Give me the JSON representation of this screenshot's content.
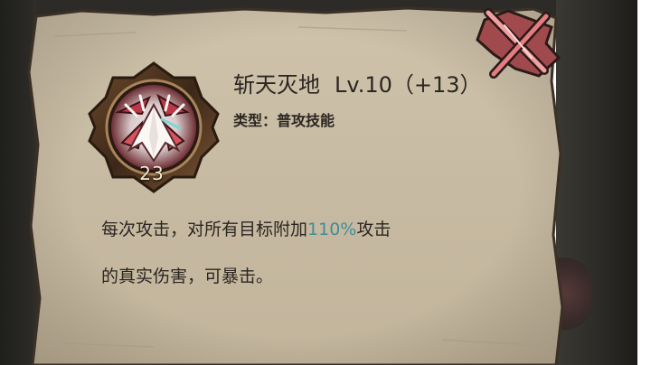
{
  "skill": {
    "name": "斩天灭地",
    "level_text": "Lv.10（+13）",
    "type_label": "类型：",
    "type_value": "普攻技能",
    "icon_badge": "23",
    "icon_name": "sword-slash-icon"
  },
  "description": {
    "line1_prefix": "每次攻击，对所有目标附加",
    "line1_highlight": "110%",
    "line1_suffix": "攻击",
    "line2": "的真实伤害，可暴击。"
  },
  "colors": {
    "parchment": "#c8bba4",
    "text": "#2b2621",
    "highlight": "#3f8d98",
    "close_accent": "#e06a6a"
  }
}
